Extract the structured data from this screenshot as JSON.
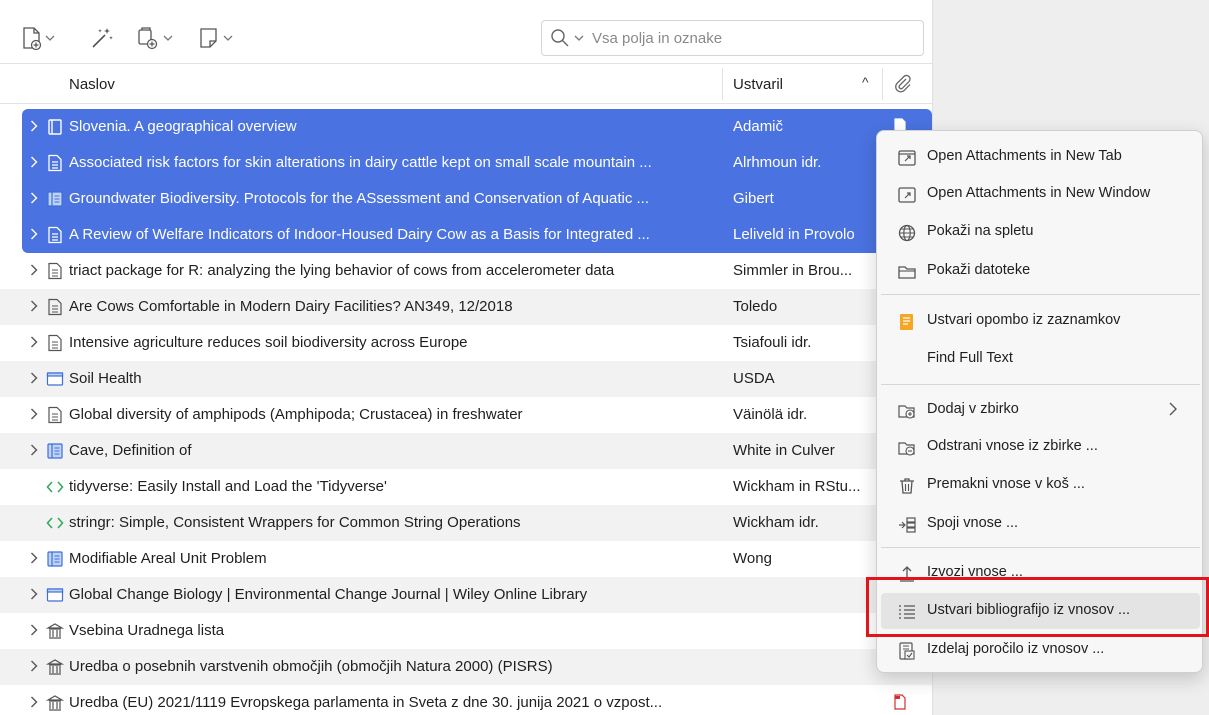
{
  "toolbar": {
    "buttons": [
      {
        "icon": "new-item-icon"
      },
      {
        "icon": "magic-wand-icon"
      },
      {
        "icon": "add-attachment-icon"
      },
      {
        "icon": "new-note-icon"
      }
    ],
    "search_placeholder": "Vsa polja in oznake"
  },
  "columns": {
    "title": "Naslov",
    "creator": "Ustvaril",
    "sort_indicator": "^",
    "attachments_icon": "paperclip-icon"
  },
  "items": [
    {
      "title": "Slovenia. A geographical overview",
      "creator": "Adamič",
      "icon": "book-icon",
      "expandable": true,
      "selected": true,
      "attachment": "pdf-icon"
    },
    {
      "title": "Associated risk factors for skin alterations in dairy cattle kept on small scale mountain ...",
      "creator": "Alrhmoun idr.",
      "icon": "journal-article-icon",
      "expandable": true,
      "selected": true
    },
    {
      "title": "Groundwater Biodiversity. Protocols for the ASsessment and Conservation of Aquatic ...",
      "creator": "Gibert",
      "icon": "report-icon",
      "expandable": true,
      "selected": true
    },
    {
      "title": "A Review of Welfare Indicators of Indoor-Housed Dairy Cow as a Basis for Integrated ...",
      "creator": "Leliveld in Provolo",
      "icon": "journal-article-icon",
      "expandable": true,
      "selected": true
    },
    {
      "title": "triact package for R: analyzing the lying behavior of cows from accelerometer data",
      "creator": "Simmler in Brou...",
      "icon": "document-icon",
      "expandable": true,
      "selected": false
    },
    {
      "title": "Are Cows Comfortable in Modern Dairy Facilities? AN349, 12/2018",
      "creator": "Toledo",
      "icon": "document-icon",
      "expandable": true,
      "selected": false
    },
    {
      "title": "Intensive agriculture reduces soil biodiversity across Europe",
      "creator": "Tsiafouli idr.",
      "icon": "document-icon",
      "expandable": true,
      "selected": false
    },
    {
      "title": "Soil Health",
      "creator": "USDA",
      "icon": "webpage-icon",
      "expandable": true,
      "selected": false
    },
    {
      "title": "Global diversity of amphipods (Amphipoda; Crustacea) in freshwater",
      "creator": "Väinölä idr.",
      "icon": "document-icon",
      "expandable": true,
      "selected": false
    },
    {
      "title": "Cave, Definition of",
      "creator": "White in Culver",
      "icon": "report-icon",
      "expandable": true,
      "selected": false
    },
    {
      "title": "tidyverse: Easily Install and Load the 'Tidyverse'",
      "creator": "Wickham in RStu...",
      "icon": "code-icon",
      "expandable": false,
      "selected": false
    },
    {
      "title": "stringr: Simple, Consistent Wrappers for Common String Operations",
      "creator": "Wickham idr.",
      "icon": "code-icon",
      "expandable": false,
      "selected": false
    },
    {
      "title": "Modifiable Areal Unit Problem",
      "creator": "Wong",
      "icon": "report-icon",
      "expandable": true,
      "selected": false
    },
    {
      "title": "Global Change Biology | Environmental Change Journal | Wiley Online Library",
      "creator": "",
      "icon": "webpage-icon",
      "expandable": true,
      "selected": false
    },
    {
      "title": "Vsebina Uradnega lista",
      "creator": "",
      "icon": "statute-icon",
      "expandable": true,
      "selected": false
    },
    {
      "title": "Uredba o posebnih varstvenih območjih (območjih Natura 2000) (PISRS)",
      "creator": "",
      "icon": "statute-icon",
      "expandable": true,
      "selected": false
    },
    {
      "title": "Uredba (EU) 2021/1119 Evropskega parlamenta in Sveta z dne 30. junija 2021 o vzpost...",
      "creator": "",
      "icon": "statute-icon",
      "expandable": true,
      "selected": false,
      "attachment": "pdf-icon"
    }
  ],
  "context_menu": {
    "items": [
      {
        "label": "Open Attachments in New Tab",
        "icon": "open-tab-icon"
      },
      {
        "label": "Open Attachments in New Window",
        "icon": "open-window-icon"
      },
      {
        "label": "Pokaži na spletu",
        "icon": "globe-icon"
      },
      {
        "label": "Pokaži datoteke",
        "icon": "folder-icon"
      },
      {
        "label": "Ustvari opombo iz zaznamkov",
        "icon": "note-annotation-icon"
      },
      {
        "label": "Find Full Text",
        "icon": ""
      },
      {
        "label": "Dodaj v zbirko",
        "icon": "add-to-collection-icon",
        "submenu": true
      },
      {
        "label": "Odstrani vnose iz zbirke ...",
        "icon": "remove-from-collection-icon"
      },
      {
        "label": "Premakni vnose v koš ...",
        "icon": "trash-icon"
      },
      {
        "label": "Spoji vnose ...",
        "icon": "merge-icon"
      },
      {
        "label": "Izvozi vnose ...",
        "icon": "export-icon"
      },
      {
        "label": "Ustvari bibliografijo iz vnosov ...",
        "icon": "bibliography-icon",
        "highlighted": true
      },
      {
        "label": "Izdelaj poročilo iz vnosov ...",
        "icon": "report-generate-icon"
      }
    ]
  },
  "colors": {
    "selection": "#4a72e0",
    "callout": "#e0141a",
    "pdf": "#d32f2f",
    "note": "#f5a623",
    "code": "#3aa860"
  }
}
